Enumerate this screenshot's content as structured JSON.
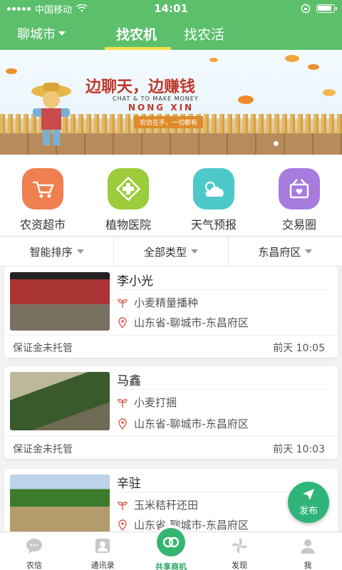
{
  "status": {
    "carrier": "中国移动",
    "time": "14:01"
  },
  "header": {
    "city": "聊城市",
    "tabs": [
      "找农机",
      "找农活"
    ]
  },
  "banner": {
    "headline": "边聊天，边赚钱",
    "sub_en": "CHAT & TO MAKE MONEY",
    "brand": "NONG XIN",
    "tagline": "农信在手，一切都有"
  },
  "quick": [
    {
      "label": "农资超市",
      "color": "#f07f4f"
    },
    {
      "label": "植物医院",
      "color": "#9ccc3a"
    },
    {
      "label": "天气预报",
      "color": "#4ec9c9"
    },
    {
      "label": "交易圈",
      "color": "#a77cde"
    }
  ],
  "filters": [
    "智能排序",
    "全部类型",
    "东昌府区"
  ],
  "cards": [
    {
      "name": "李小光",
      "service": "小麦精量播种",
      "location": "山东省-聊城市-东昌府区",
      "deposit": "保证金未托管",
      "time": "前天 10:05"
    },
    {
      "name": "马鑫",
      "service": "小麦打捆",
      "location": "山东省-聊城市-东昌府区",
      "deposit": "保证金未托管",
      "time": "前天 10:03"
    },
    {
      "name": "辛驻",
      "service": "玉米秸秆还田",
      "location": "山东省-聊城市-东昌府区"
    }
  ],
  "publish": "发布",
  "tabbar": [
    "农信",
    "通讯录",
    "共享商机",
    "发现",
    "我"
  ]
}
